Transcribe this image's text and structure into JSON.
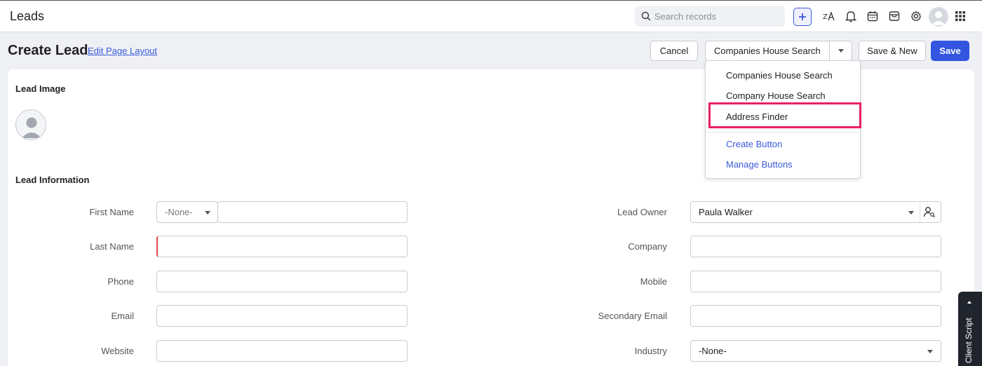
{
  "topbar": {
    "app_title": "Leads",
    "search_placeholder": "Search records"
  },
  "header": {
    "page_title": "Create Lead",
    "edit_layout_link": "Edit Page Layout",
    "cancel_label": "Cancel",
    "split_button_label": "Companies House Search",
    "save_new_label": "Save & New",
    "save_label": "Save"
  },
  "dropdown": {
    "items": [
      {
        "label": "Companies House Search"
      },
      {
        "label": "Company House Search"
      },
      {
        "label": "Address Finder"
      },
      {
        "label": "Create Button"
      },
      {
        "label": "Manage Buttons"
      }
    ],
    "highlight_color": "#e8215f"
  },
  "sections": {
    "lead_image": "Lead Image",
    "lead_information": "Lead Information"
  },
  "form": {
    "left": [
      {
        "label": "First Name",
        "salutation": "-None-",
        "value": ""
      },
      {
        "label": "Last Name",
        "value": ""
      },
      {
        "label": "Phone",
        "value": ""
      },
      {
        "label": "Email",
        "value": ""
      },
      {
        "label": "Website",
        "value": ""
      }
    ],
    "right": [
      {
        "label": "Lead Owner",
        "value": "Paula Walker"
      },
      {
        "label": "Company",
        "value": ""
      },
      {
        "label": "Mobile",
        "value": ""
      },
      {
        "label": "Secondary Email",
        "value": ""
      },
      {
        "label": "Industry",
        "value": "-None-"
      }
    ]
  },
  "client_script": {
    "label": "Client Script"
  },
  "colors": {
    "accent": "#3256e0",
    "link": "#3b5bdb",
    "required": "#e24b4b"
  }
}
